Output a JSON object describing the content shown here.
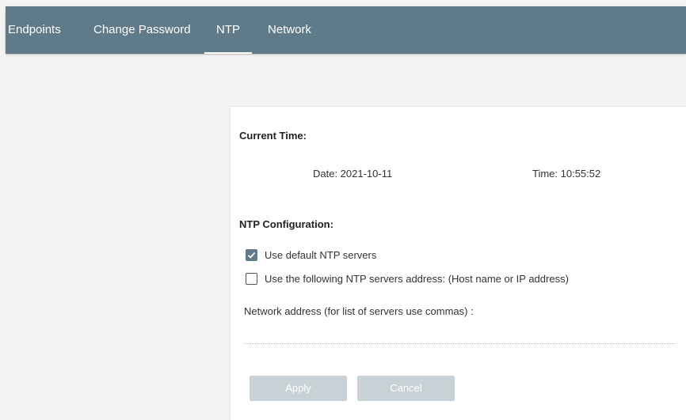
{
  "nav": {
    "tabs": [
      {
        "label": "Endpoints",
        "active": false
      },
      {
        "label": "Change Password",
        "active": false
      },
      {
        "label": "NTP",
        "active": true
      },
      {
        "label": "Network",
        "active": false
      }
    ]
  },
  "current_time": {
    "title": "Current Time:",
    "date": "Date: 2021-10-11",
    "time": "Time: 10:55:52"
  },
  "ntp_config": {
    "title": "NTP Configuration:",
    "options": [
      {
        "label": "Use default NTP servers",
        "checked": true
      },
      {
        "label": "Use the following NTP servers address: (Host name or IP address)",
        "checked": false
      }
    ],
    "network_address_label": "Network address (for list of servers use commas) :",
    "network_address_value": ""
  },
  "actions": {
    "apply": "Apply",
    "cancel": "Cancel"
  },
  "colors": {
    "header_bg": "#5f7b89",
    "button_disabled": "#c7d1d6"
  },
  "icons": [
    "check-icon"
  ]
}
